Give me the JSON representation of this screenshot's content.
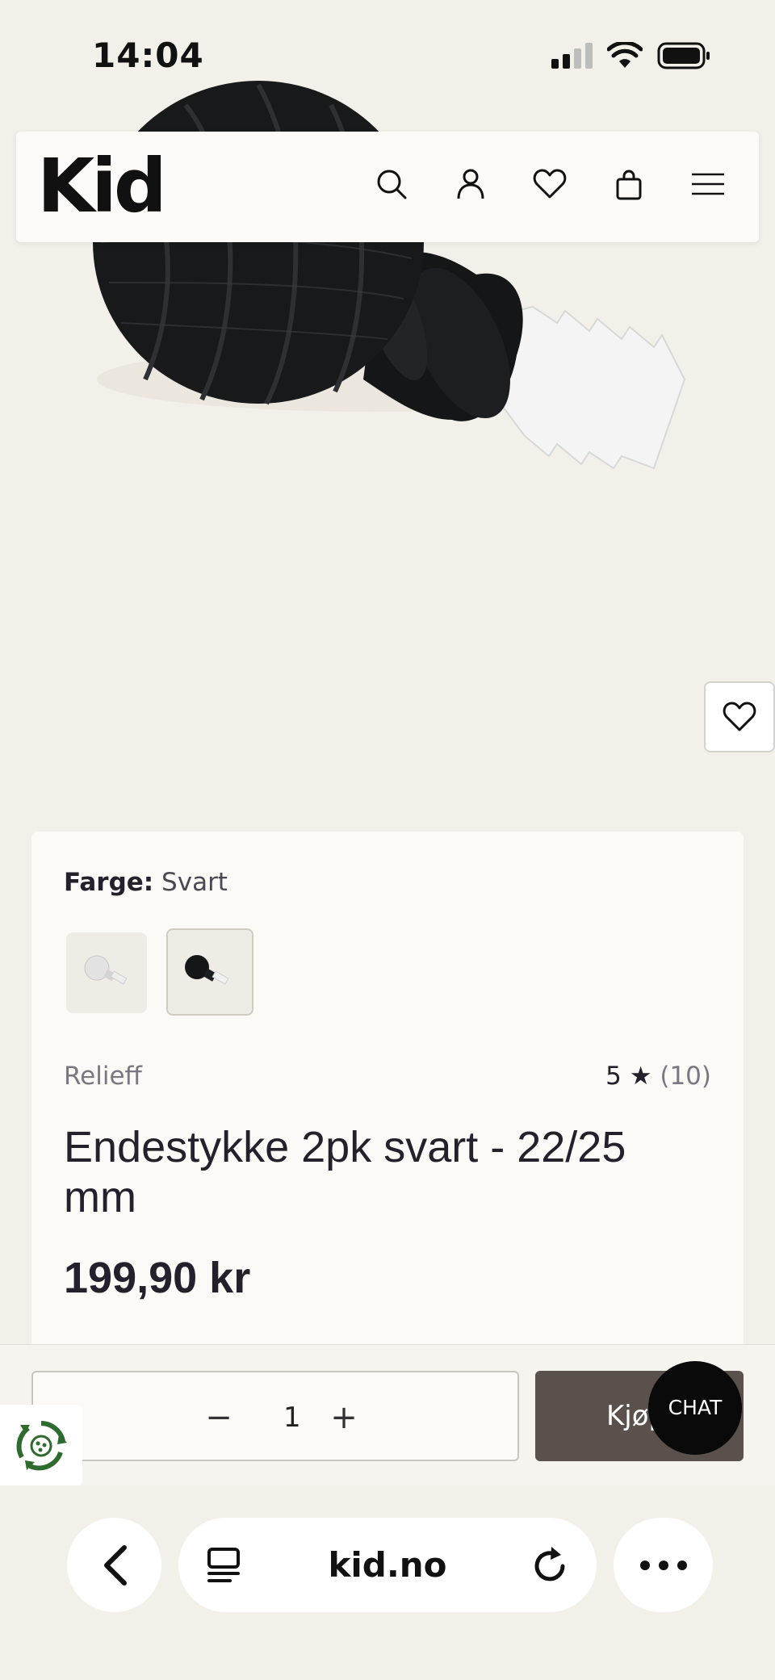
{
  "status_bar": {
    "time": "14:04"
  },
  "header": {
    "logo": "Kid"
  },
  "product": {
    "color_label": "Farge:",
    "color_value": "Svart",
    "brand": "Relieff",
    "rating": "5 ★",
    "rating_count": "(10)",
    "title": "Endestykke 2pk svart - 22/25 mm",
    "price": "199,90 kr"
  },
  "purchase": {
    "minus": "−",
    "quantity": "1",
    "plus": "+",
    "buy_label": "Kjøp",
    "chat_label": "CHAT"
  },
  "browser": {
    "url": "kid.no"
  }
}
